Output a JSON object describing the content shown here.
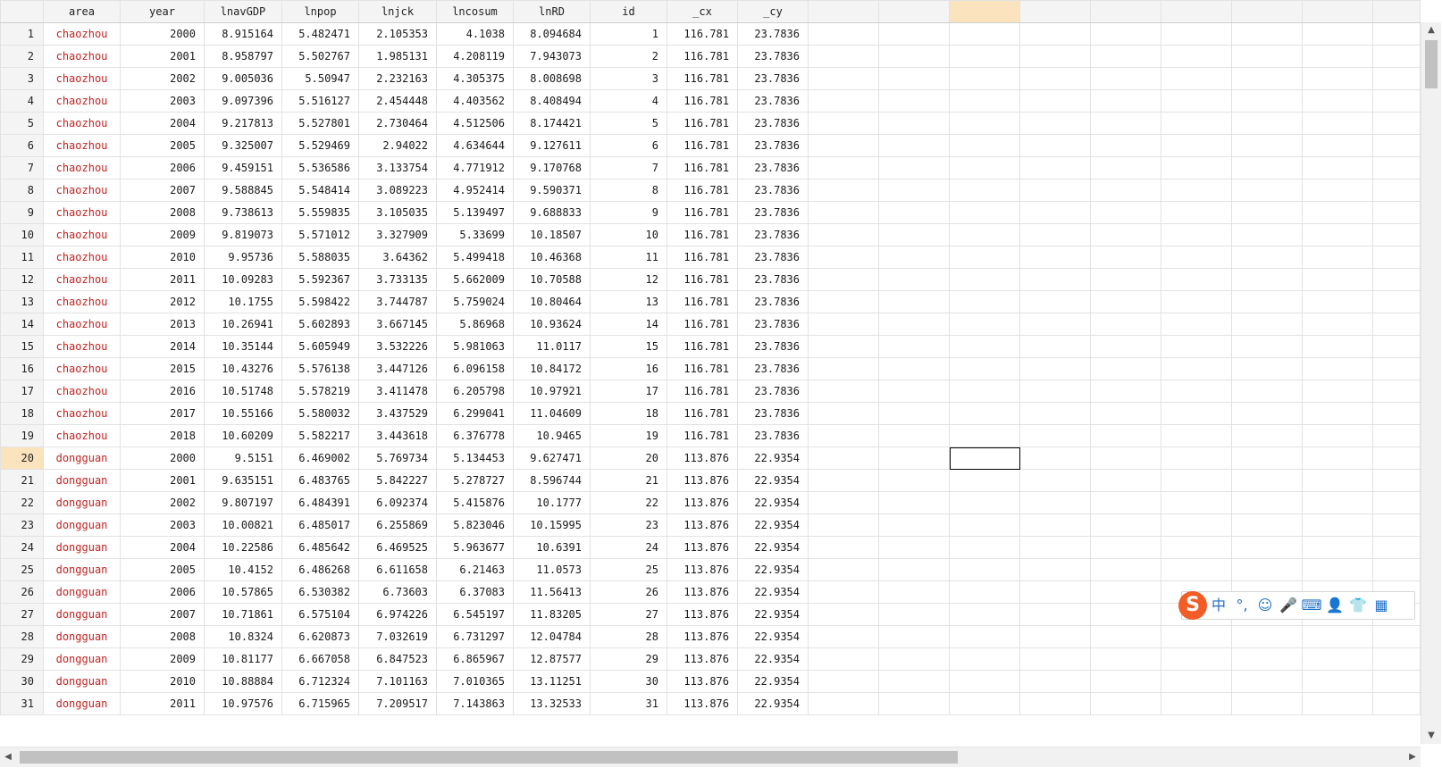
{
  "columns": [
    "area",
    "year",
    "lnavGDP",
    "lnpop",
    "lnjck",
    "lncosum",
    "lnRD",
    "id",
    "_cx",
    "_cy"
  ],
  "highlighted_row": 20,
  "highlighted_column_index": 13,
  "rows": [
    [
      "1",
      "chaozhou",
      "2000",
      "8.915164",
      "5.482471",
      "2.105353",
      "4.1038",
      "8.094684",
      "1",
      "116.781",
      "23.7836"
    ],
    [
      "2",
      "chaozhou",
      "2001",
      "8.958797",
      "5.502767",
      "1.985131",
      "4.208119",
      "7.943073",
      "2",
      "116.781",
      "23.7836"
    ],
    [
      "3",
      "chaozhou",
      "2002",
      "9.005036",
      "5.50947",
      "2.232163",
      "4.305375",
      "8.008698",
      "3",
      "116.781",
      "23.7836"
    ],
    [
      "4",
      "chaozhou",
      "2003",
      "9.097396",
      "5.516127",
      "2.454448",
      "4.403562",
      "8.408494",
      "4",
      "116.781",
      "23.7836"
    ],
    [
      "5",
      "chaozhou",
      "2004",
      "9.217813",
      "5.527801",
      "2.730464",
      "4.512506",
      "8.174421",
      "5",
      "116.781",
      "23.7836"
    ],
    [
      "6",
      "chaozhou",
      "2005",
      "9.325007",
      "5.529469",
      "2.94022",
      "4.634644",
      "9.127611",
      "6",
      "116.781",
      "23.7836"
    ],
    [
      "7",
      "chaozhou",
      "2006",
      "9.459151",
      "5.536586",
      "3.133754",
      "4.771912",
      "9.170768",
      "7",
      "116.781",
      "23.7836"
    ],
    [
      "8",
      "chaozhou",
      "2007",
      "9.588845",
      "5.548414",
      "3.089223",
      "4.952414",
      "9.590371",
      "8",
      "116.781",
      "23.7836"
    ],
    [
      "9",
      "chaozhou",
      "2008",
      "9.738613",
      "5.559835",
      "3.105035",
      "5.139497",
      "9.688833",
      "9",
      "116.781",
      "23.7836"
    ],
    [
      "10",
      "chaozhou",
      "2009",
      "9.819073",
      "5.571012",
      "3.327909",
      "5.33699",
      "10.18507",
      "10",
      "116.781",
      "23.7836"
    ],
    [
      "11",
      "chaozhou",
      "2010",
      "9.95736",
      "5.588035",
      "3.64362",
      "5.499418",
      "10.46368",
      "11",
      "116.781",
      "23.7836"
    ],
    [
      "12",
      "chaozhou",
      "2011",
      "10.09283",
      "5.592367",
      "3.733135",
      "5.662009",
      "10.70588",
      "12",
      "116.781",
      "23.7836"
    ],
    [
      "13",
      "chaozhou",
      "2012",
      "10.1755",
      "5.598422",
      "3.744787",
      "5.759024",
      "10.80464",
      "13",
      "116.781",
      "23.7836"
    ],
    [
      "14",
      "chaozhou",
      "2013",
      "10.26941",
      "5.602893",
      "3.667145",
      "5.86968",
      "10.93624",
      "14",
      "116.781",
      "23.7836"
    ],
    [
      "15",
      "chaozhou",
      "2014",
      "10.35144",
      "5.605949",
      "3.532226",
      "5.981063",
      "11.0117",
      "15",
      "116.781",
      "23.7836"
    ],
    [
      "16",
      "chaozhou",
      "2015",
      "10.43276",
      "5.576138",
      "3.447126",
      "6.096158",
      "10.84172",
      "16",
      "116.781",
      "23.7836"
    ],
    [
      "17",
      "chaozhou",
      "2016",
      "10.51748",
      "5.578219",
      "3.411478",
      "6.205798",
      "10.97921",
      "17",
      "116.781",
      "23.7836"
    ],
    [
      "18",
      "chaozhou",
      "2017",
      "10.55166",
      "5.580032",
      "3.437529",
      "6.299041",
      "11.04609",
      "18",
      "116.781",
      "23.7836"
    ],
    [
      "19",
      "chaozhou",
      "2018",
      "10.60209",
      "5.582217",
      "3.443618",
      "6.376778",
      "10.9465",
      "19",
      "116.781",
      "23.7836"
    ],
    [
      "20",
      "dongguan",
      "2000",
      "9.5151",
      "6.469002",
      "5.769734",
      "5.134453",
      "9.627471",
      "20",
      "113.876",
      "22.9354"
    ],
    [
      "21",
      "dongguan",
      "2001",
      "9.635151",
      "6.483765",
      "5.842227",
      "5.278727",
      "8.596744",
      "21",
      "113.876",
      "22.9354"
    ],
    [
      "22",
      "dongguan",
      "2002",
      "9.807197",
      "6.484391",
      "6.092374",
      "5.415876",
      "10.1777",
      "22",
      "113.876",
      "22.9354"
    ],
    [
      "23",
      "dongguan",
      "2003",
      "10.00821",
      "6.485017",
      "6.255869",
      "5.823046",
      "10.15995",
      "23",
      "113.876",
      "22.9354"
    ],
    [
      "24",
      "dongguan",
      "2004",
      "10.22586",
      "6.485642",
      "6.469525",
      "5.963677",
      "10.6391",
      "24",
      "113.876",
      "22.9354"
    ],
    [
      "25",
      "dongguan",
      "2005",
      "10.4152",
      "6.486268",
      "6.611658",
      "6.21463",
      "11.0573",
      "25",
      "113.876",
      "22.9354"
    ],
    [
      "26",
      "dongguan",
      "2006",
      "10.57865",
      "6.530382",
      "6.73603",
      "6.37083",
      "11.56413",
      "26",
      "113.876",
      "22.9354"
    ],
    [
      "27",
      "dongguan",
      "2007",
      "10.71861",
      "6.575104",
      "6.974226",
      "6.545197",
      "11.83205",
      "27",
      "113.876",
      "22.9354"
    ],
    [
      "28",
      "dongguan",
      "2008",
      "10.8324",
      "6.620873",
      "7.032619",
      "6.731297",
      "12.04784",
      "28",
      "113.876",
      "22.9354"
    ],
    [
      "29",
      "dongguan",
      "2009",
      "10.81177",
      "6.667058",
      "6.847523",
      "6.865967",
      "12.87577",
      "29",
      "113.876",
      "22.9354"
    ],
    [
      "30",
      "dongguan",
      "2010",
      "10.88884",
      "6.712324",
      "7.101163",
      "7.010365",
      "13.11251",
      "30",
      "113.876",
      "22.9354"
    ],
    [
      "31",
      "dongguan",
      "2011",
      "10.97576",
      "6.715965",
      "7.209517",
      "7.143863",
      "13.32533",
      "31",
      "113.876",
      "22.9354"
    ]
  ],
  "ime_toolbar": {
    "logo": "S",
    "items": [
      {
        "name": "chinese-mode-icon",
        "glyph": "中"
      },
      {
        "name": "punctuation-icon",
        "glyph": "°,"
      },
      {
        "name": "emoji-icon",
        "glyph": "☺"
      },
      {
        "name": "microphone-icon",
        "glyph": "🎤"
      },
      {
        "name": "keyboard-icon",
        "glyph": "⌨"
      },
      {
        "name": "user-icon",
        "glyph": "👤"
      },
      {
        "name": "skin-icon",
        "glyph": "👕"
      },
      {
        "name": "toolbox-icon",
        "glyph": "▦"
      }
    ]
  }
}
